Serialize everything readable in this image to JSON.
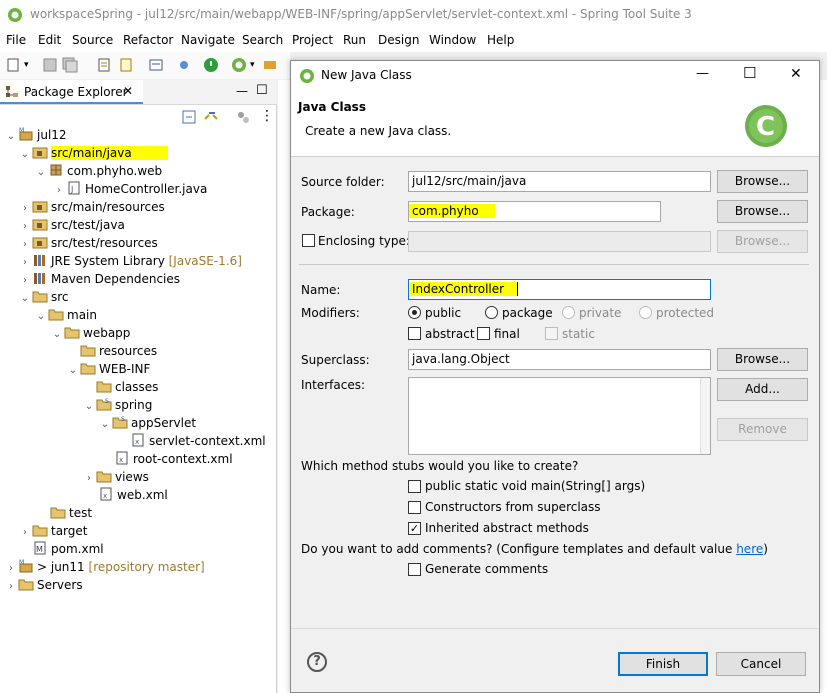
{
  "window": {
    "title": "workspaceSpring - jul12/src/main/webapp/WEB-INF/spring/appServlet/servlet-context.xml - Spring Tool Suite 3"
  },
  "menu": [
    "File",
    "Edit",
    "Source",
    "Refactor",
    "Navigate",
    "Search",
    "Project",
    "Run",
    "Design",
    "Window",
    "Help"
  ],
  "explorer": {
    "tab_label": "Package Explorer",
    "items": [
      {
        "label": "jul12",
        "annotation": ""
      },
      {
        "label": "src/main/java",
        "annotation": ""
      },
      {
        "label": "com.phyho.web",
        "annotation": ""
      },
      {
        "label": "HomeController.java",
        "annotation": ""
      },
      {
        "label": "src/main/resources",
        "annotation": ""
      },
      {
        "label": "src/test/java",
        "annotation": ""
      },
      {
        "label": "src/test/resources",
        "annotation": ""
      },
      {
        "label": "JRE System Library",
        "annotation": "[JavaSE-1.6]"
      },
      {
        "label": "Maven Dependencies",
        "annotation": ""
      },
      {
        "label": "src",
        "annotation": ""
      },
      {
        "label": "main",
        "annotation": ""
      },
      {
        "label": "webapp",
        "annotation": ""
      },
      {
        "label": "resources",
        "annotation": ""
      },
      {
        "label": "WEB-INF",
        "annotation": ""
      },
      {
        "label": "classes",
        "annotation": ""
      },
      {
        "label": "spring",
        "annotation": ""
      },
      {
        "label": "appServlet",
        "annotation": ""
      },
      {
        "label": "servlet-context.xml",
        "annotation": ""
      },
      {
        "label": "root-context.xml",
        "annotation": ""
      },
      {
        "label": "views",
        "annotation": ""
      },
      {
        "label": "web.xml",
        "annotation": ""
      },
      {
        "label": "test",
        "annotation": ""
      },
      {
        "label": "target",
        "annotation": ""
      },
      {
        "label": "pom.xml",
        "annotation": ""
      },
      {
        "label": "> jun11",
        "annotation": "[repository master]"
      },
      {
        "label": "Servers",
        "annotation": ""
      }
    ]
  },
  "dialog": {
    "title": "New Java Class",
    "heading": "Java Class",
    "subheading": "Create a new Java class.",
    "source_folder_label": "Source folder:",
    "source_folder_value": "jul12/src/main/java",
    "package_label": "Package:",
    "package_value": "com.phyho",
    "enclosing_label": "Enclosing type:",
    "enclosing_value": "",
    "name_label": "Name:",
    "name_value": "IndexController",
    "modifiers_label": "Modifiers:",
    "mod_public": "public",
    "mod_package": "package",
    "mod_private": "private",
    "mod_protected": "protected",
    "mod_abstract": "abstract",
    "mod_final": "final",
    "mod_static": "static",
    "superclass_label": "Superclass:",
    "superclass_value": "java.lang.Object",
    "interfaces_label": "Interfaces:",
    "browse_label": "Browse...",
    "add_label": "Add...",
    "remove_label": "Remove",
    "stubs_question": "Which method stubs would you like to create?",
    "stub_main": "public static void main(String[] args)",
    "stub_ctor": "Constructors from superclass",
    "stub_inherited": "Inherited abstract methods",
    "comments_question": "Do you want to add comments? (Configure templates and default value",
    "comments_link": "here",
    "comments_close": ")",
    "generate_comments": "Generate comments",
    "finish_label": "Finish",
    "cancel_label": "Cancel",
    "help_glyph": "?",
    "minimize_glyph": "—",
    "maximize_glyph": "☐",
    "close_glyph": "✕"
  },
  "colors": {
    "highlight": "#ffff00",
    "accent": "#0078d7",
    "spring_green": "#6db33f",
    "annotation": "#9b7b2f"
  }
}
